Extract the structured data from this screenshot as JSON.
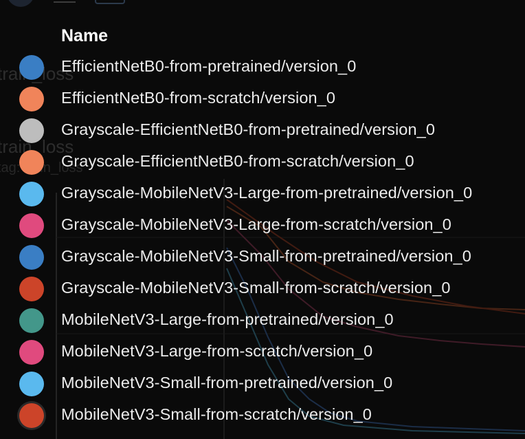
{
  "background": {
    "title_1": "train_loss",
    "title_2": "train_loss",
    "subtitle": "tag: train_loss"
  },
  "legend": {
    "header": "Name",
    "items": [
      {
        "label": "EfficientNetB0-from-pretrained/version_0",
        "color": "#3a7ec4"
      },
      {
        "label": "EfficientNetB0-from-scratch/version_0",
        "color": "#f0845a"
      },
      {
        "label": "Grayscale-EfficientNetB0-from-pretrained/version_0",
        "color": "#bdbdbd"
      },
      {
        "label": "Grayscale-EfficientNetB0-from-scratch/version_0",
        "color": "#f0845a"
      },
      {
        "label": "Grayscale-MobileNetV3-Large-from-pretrained/version_0",
        "color": "#5ab9ee"
      },
      {
        "label": "Grayscale-MobileNetV3-Large-from-scratch/version_0",
        "color": "#e04a7e"
      },
      {
        "label": "Grayscale-MobileNetV3-Small-from-pretrained/version_0",
        "color": "#3a7ec4"
      },
      {
        "label": "Grayscale-MobileNetV3-Small-from-scratch/version_0",
        "color": "#cc4429"
      },
      {
        "label": "MobileNetV3-Large-from-pretrained/version_0",
        "color": "#43978a"
      },
      {
        "label": "MobileNetV3-Large-from-scratch/version_0",
        "color": "#e04a7e"
      },
      {
        "label": "MobileNetV3-Small-from-pretrained/version_0",
        "color": "#5ab9ee"
      },
      {
        "label": "MobileNetV3-Small-from-scratch/version_0",
        "color": "#cc4429"
      }
    ]
  }
}
